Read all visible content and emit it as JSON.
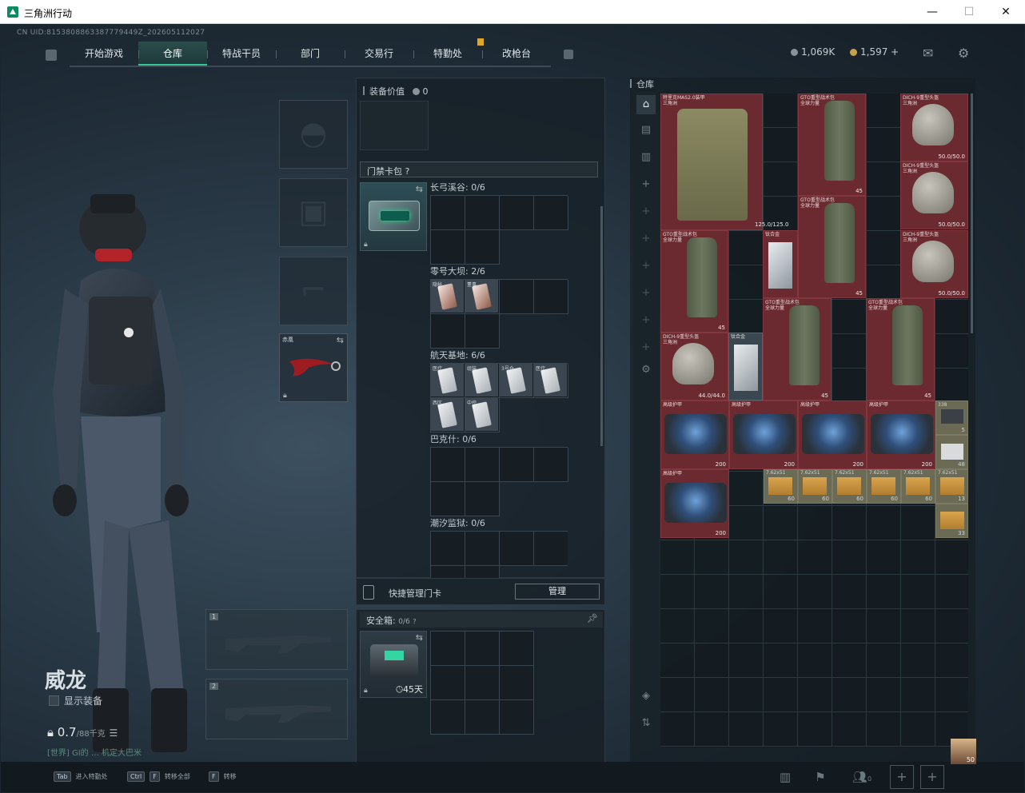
{
  "window": {
    "title": "三角洲行动",
    "minimize": "—",
    "maximize": "☐",
    "close": "✕"
  },
  "uid": "CN UID:8153808863387779449Z_202605112027",
  "nav": {
    "tabs": [
      "开始游戏",
      "仓库",
      "特战干员",
      "部门",
      "交易行",
      "特勤处",
      "改枪台"
    ],
    "active": "仓库"
  },
  "currency": {
    "a": "1,069K",
    "b": "1,597 +"
  },
  "operator": {
    "name": "威龙",
    "show_gear": "显示装备",
    "weight": "0.7",
    "weight_max": "/88千克",
    "tag": "[世界] GI的 …  机定大巴米"
  },
  "gear_slots": {
    "knife_label": "赤凰"
  },
  "weapon_slots": [
    "1",
    "2"
  ],
  "mid": {
    "equip_value_label": "装备价值",
    "equip_value": "0",
    "keycard_section": "门禁卡包 ?",
    "areas": [
      {
        "name": "长弓溪谷: 0/6"
      },
      {
        "name": "零号大坝: 2/6",
        "cards": [
          "隐秘",
          "董事"
        ]
      },
      {
        "name": "航天基地: 6/6",
        "cards": [
          "医疗",
          "组装",
          "3号仓",
          "医疗",
          "西区",
          "中控"
        ]
      },
      {
        "name": "巴克什: 0/6"
      },
      {
        "name": "潮汐监狱: 0/6"
      }
    ],
    "quick_manage": "快捷管理门卡",
    "manage_btn": "管理",
    "safebox_label": "安全箱:",
    "safebox_count": "0/6",
    "safebox_timer": "45天"
  },
  "stash": {
    "title": "仓库",
    "items": [
      {
        "label": "特里克MAS2.0装甲\n三角洲"
      },
      {
        "label": "GTO重型战术包\n全球力量",
        "num": "45"
      },
      {
        "label": "DICH-9重型头盔\n三角洲",
        "num": "50.0/50.0"
      },
      {
        "label": "DICH-9重型头盔\n三角洲",
        "num": "50.0/50.0"
      },
      {
        "label": "GTO重型战术包\n全球力量",
        "num": "45"
      },
      {
        "label": "GTO重型战术包\n全球力量",
        "num": "45"
      },
      {
        "label": "钛合金",
        "num": "125.0/125.0"
      },
      {
        "label": "DICH-9重型头盔\n三角洲",
        "num": "50.0/50.0"
      },
      {
        "label": "GTO重型战术包\n全球力量",
        "num": "45"
      },
      {
        "label": "GTO重型战术包\n全球力量",
        "num": "45"
      },
      {
        "label": "DICH-9重型头盔\n三角洲",
        "num": "44.0/44.0"
      },
      {
        "label": "钛合金"
      },
      {
        "label": "高级护甲",
        "num": "200"
      },
      {
        "label": "高级护甲",
        "num": "200"
      },
      {
        "label": "高级护甲",
        "num": "200"
      },
      {
        "label": "高级护甲",
        "num": "200"
      },
      {
        "label": "高级护甲",
        "num": "200"
      },
      {
        "label": "338",
        "num": "5"
      },
      {
        "label": "",
        "num": "48"
      },
      {
        "label": "7.62x51",
        "num": "60"
      },
      {
        "label": "7.62x51",
        "num": "60"
      },
      {
        "label": "7.62x51",
        "num": "60"
      },
      {
        "label": "7.62x51",
        "num": "60"
      },
      {
        "label": "7.62x51",
        "num": "60"
      },
      {
        "label": "7.62x51",
        "num": "13"
      },
      {
        "label": "",
        "num": "33"
      }
    ]
  },
  "bottom": {
    "k1": "Tab",
    "t1": "进入特勤处",
    "k2": "Ctrl",
    "k2b": "F",
    "t2": "转移全部",
    "k3": "F",
    "t3": "转移",
    "friends": "0",
    "avatar_num": "50"
  }
}
